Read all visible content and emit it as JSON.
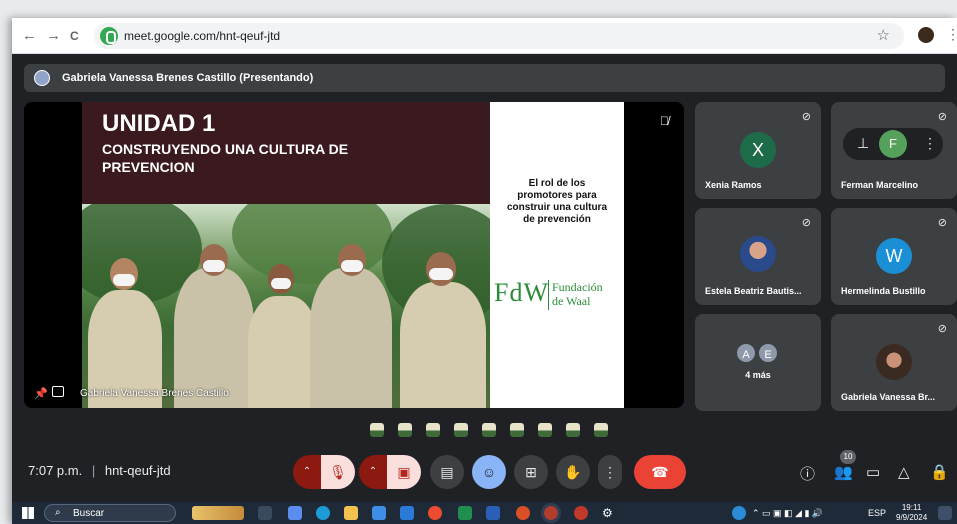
{
  "browser": {
    "back": "←",
    "forward": "→",
    "reload": "C",
    "url": "meet.google.com/hnt-qeuf-jtd",
    "star": "☆",
    "menu": "⋮"
  },
  "presenter_bar": {
    "text": "Gabriela Vanessa Brenes Castillo (Presentando)"
  },
  "stage": {
    "slide_title": "UNIDAD 1",
    "slide_subtitle": "CONSTRUYENDO UNA CULTURA DE PREVENCION",
    "side_text": "El rol de los promotores para construir una cultura de prevención",
    "logo_mark": "FdW",
    "logo_text_1": "Fundación",
    "logo_text_2": "de Waal",
    "presenter_name": "Gabriela Vanessa Brenes Castillo",
    "mute_icon": "mic-off-icon"
  },
  "participants": [
    {
      "name": "Xenia Ramos",
      "initial": "X",
      "color": "#1e6b4a",
      "muted": true
    },
    {
      "name": "Ferman Marcelino",
      "initial": "F",
      "color": "#55a05a",
      "muted": true
    },
    {
      "name": "Estela Beatriz Bautis...",
      "muted": true
    },
    {
      "name": "Hermelinda Bustillo",
      "initial": "W",
      "color": "#1a8fd6",
      "muted": true
    },
    {
      "name": "4 más",
      "initials": [
        "A",
        "E"
      ]
    },
    {
      "name": "Gabriela Vanessa Br...",
      "muted": true
    }
  ],
  "controls": {
    "time": "7:07 p.m.",
    "separator": "|",
    "meeting_code": "hnt-qeuf-jtd",
    "people_count": "10",
    "accent_red": "#ea4335",
    "accent_blue": "#8ab4f8"
  },
  "taskbar": {
    "search_placeholder": "Buscar",
    "language": "ESP",
    "time": "19:11",
    "date": "9/9/2024"
  }
}
